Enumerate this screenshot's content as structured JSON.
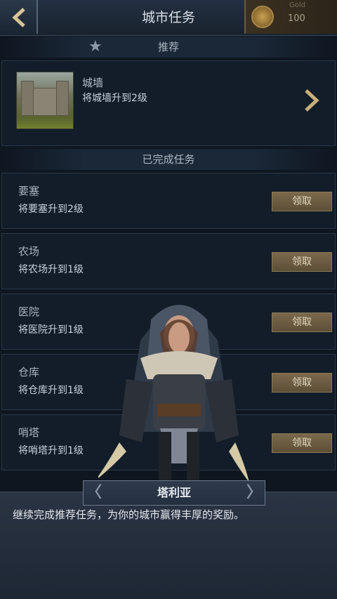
{
  "header": {
    "title": "城市任务",
    "gold_label": "Gold",
    "gold_value": "100"
  },
  "recommend": {
    "section_title": "推荐",
    "item": {
      "name": "城墙",
      "desc": "将城墙升到2级"
    }
  },
  "completed": {
    "section_title": "已完成任务",
    "tasks": [
      {
        "name": "要塞",
        "desc": "将要塞升到2级",
        "button": "领取"
      },
      {
        "name": "农场",
        "desc": "将农场升到1级",
        "button": "领取"
      },
      {
        "name": "医院",
        "desc": "将医院升到1级",
        "button": "领取"
      },
      {
        "name": "仓库",
        "desc": "将仓库升到1级",
        "button": "领取"
      },
      {
        "name": "哨塔",
        "desc": "将哨塔升到1级",
        "button": "领取"
      }
    ]
  },
  "dialog": {
    "speaker": "塔利亚",
    "text": "继续完成推荐任务，为你的城市赢得丰厚的奖励。"
  },
  "colors": {
    "accent_gold": "#7a694b",
    "panel": "#121d29"
  }
}
